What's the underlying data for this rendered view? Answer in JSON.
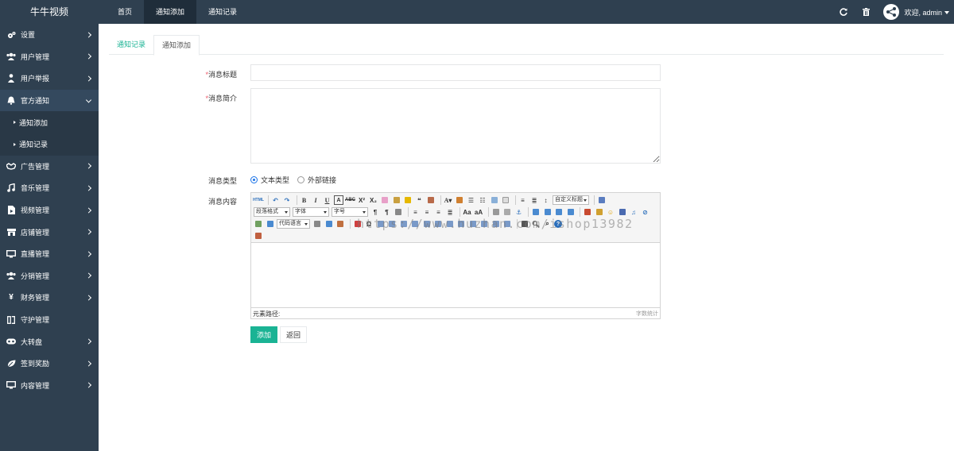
{
  "brand": "牛牛视频",
  "topnav": [
    "首页",
    "通知添加",
    "通知记录"
  ],
  "topright": {
    "welcome": "欢迎, admin"
  },
  "sidebar": {
    "items": [
      {
        "label": "设置",
        "icon": "gears-icon"
      },
      {
        "label": "用户管理",
        "icon": "users-icon"
      },
      {
        "label": "用户举报",
        "icon": "user-report-icon"
      },
      {
        "label": "官方通知",
        "icon": "bell-icon"
      },
      {
        "label": "广告管理",
        "icon": "handshake-icon"
      },
      {
        "label": "音乐管理",
        "icon": "music-icon"
      },
      {
        "label": "视频管理",
        "icon": "video-file-icon"
      },
      {
        "label": "店铺管理",
        "icon": "shop-icon"
      },
      {
        "label": "直播管理",
        "icon": "monitor-icon"
      },
      {
        "label": "分销管理",
        "icon": "group-icon"
      },
      {
        "label": "财务管理",
        "icon": "yen-icon"
      },
      {
        "label": "守护管理",
        "icon": "guard-icon"
      },
      {
        "label": "大转盘",
        "icon": "gamepad-icon"
      },
      {
        "label": "签到奖励",
        "icon": "leaf-icon"
      },
      {
        "label": "内容管理",
        "icon": "desktop-icon"
      }
    ],
    "sub": [
      "通知添加",
      "通知记录"
    ]
  },
  "tabs": [
    "通知记录",
    "通知添加"
  ],
  "form": {
    "required_mark": "*",
    "title_label": "消息标题",
    "intro_label": "消息简介",
    "type_label": "消息类型",
    "type_options": [
      "文本类型",
      "外部链接"
    ],
    "content_label": "消息内容",
    "add_button": "添加",
    "back_button": "返回"
  },
  "editor": {
    "selects": {
      "custom_title": "自定义标题",
      "paragraph": "段落格式",
      "font": "字体",
      "size": "字号",
      "code_lang": "代码语言"
    },
    "path_label": "元素路径:",
    "word_count": "字数统计",
    "watermark": "https://www.huzhan.com/ishop13982"
  },
  "colors": {
    "sidebar": "#2f4050",
    "accent": "#1ab394",
    "active_nav": "#1f2d3a"
  }
}
